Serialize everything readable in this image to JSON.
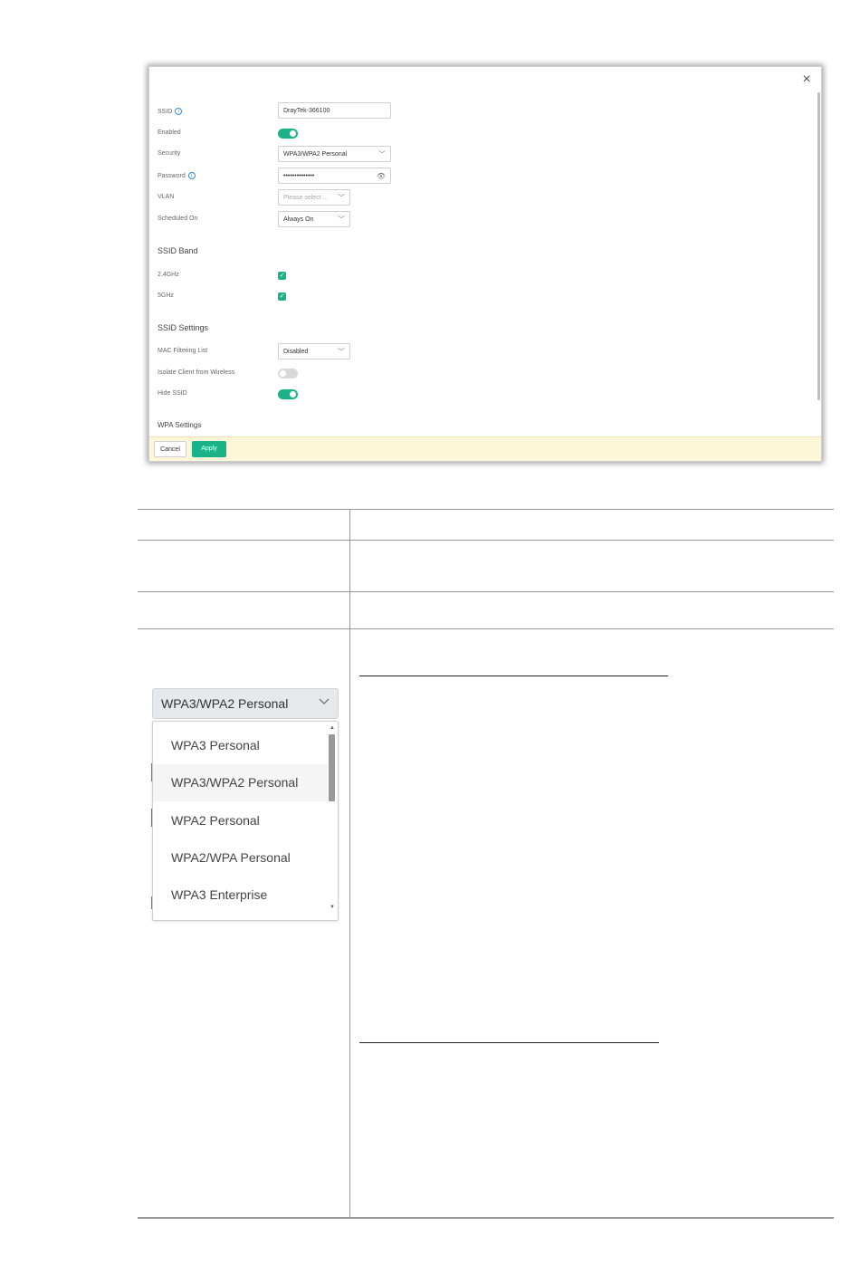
{
  "modal": {
    "close_label": "×",
    "fields": {
      "ssid": {
        "label": "SSID",
        "value": "DrayTek-366100"
      },
      "enabled": {
        "label": "Enabled",
        "state": true
      },
      "security": {
        "label": "Security",
        "value": "WPA3/WPA2 Personal"
      },
      "password": {
        "label": "Password",
        "value": "••••••••••••••"
      },
      "vlan": {
        "label": "VLAN",
        "placeholder": "Please select ..."
      },
      "scheduled": {
        "label": "Scheduled On",
        "value": "Always On"
      }
    },
    "band": {
      "heading": "SSID Band",
      "items": [
        {
          "label": "2.4GHz",
          "checked": true
        },
        {
          "label": "5GHz",
          "checked": true
        }
      ]
    },
    "settings": {
      "heading": "SSID Settings",
      "mac": {
        "label": "MAC Filtering List",
        "value": "Disabled"
      },
      "isolate": {
        "label": "Isolate Client from Wireless",
        "state": false
      },
      "hide": {
        "label": "Hide SSID",
        "state": true
      }
    },
    "wpa_heading": "WPA Settings",
    "footer": {
      "cancel_label": "Cancel",
      "apply_label": "Apply"
    }
  },
  "security_dropdown": {
    "selected": "WPA3/WPA2 Personal",
    "options": [
      "WPA3 Personal",
      "WPA3/WPA2 Personal",
      "WPA2 Personal",
      "WPA2/WPA Personal",
      "WPA3 Enterprise"
    ],
    "highlighted_index": 1
  },
  "colors": {
    "accent": "#19b387",
    "footer_bg": "#fdf6d8"
  }
}
